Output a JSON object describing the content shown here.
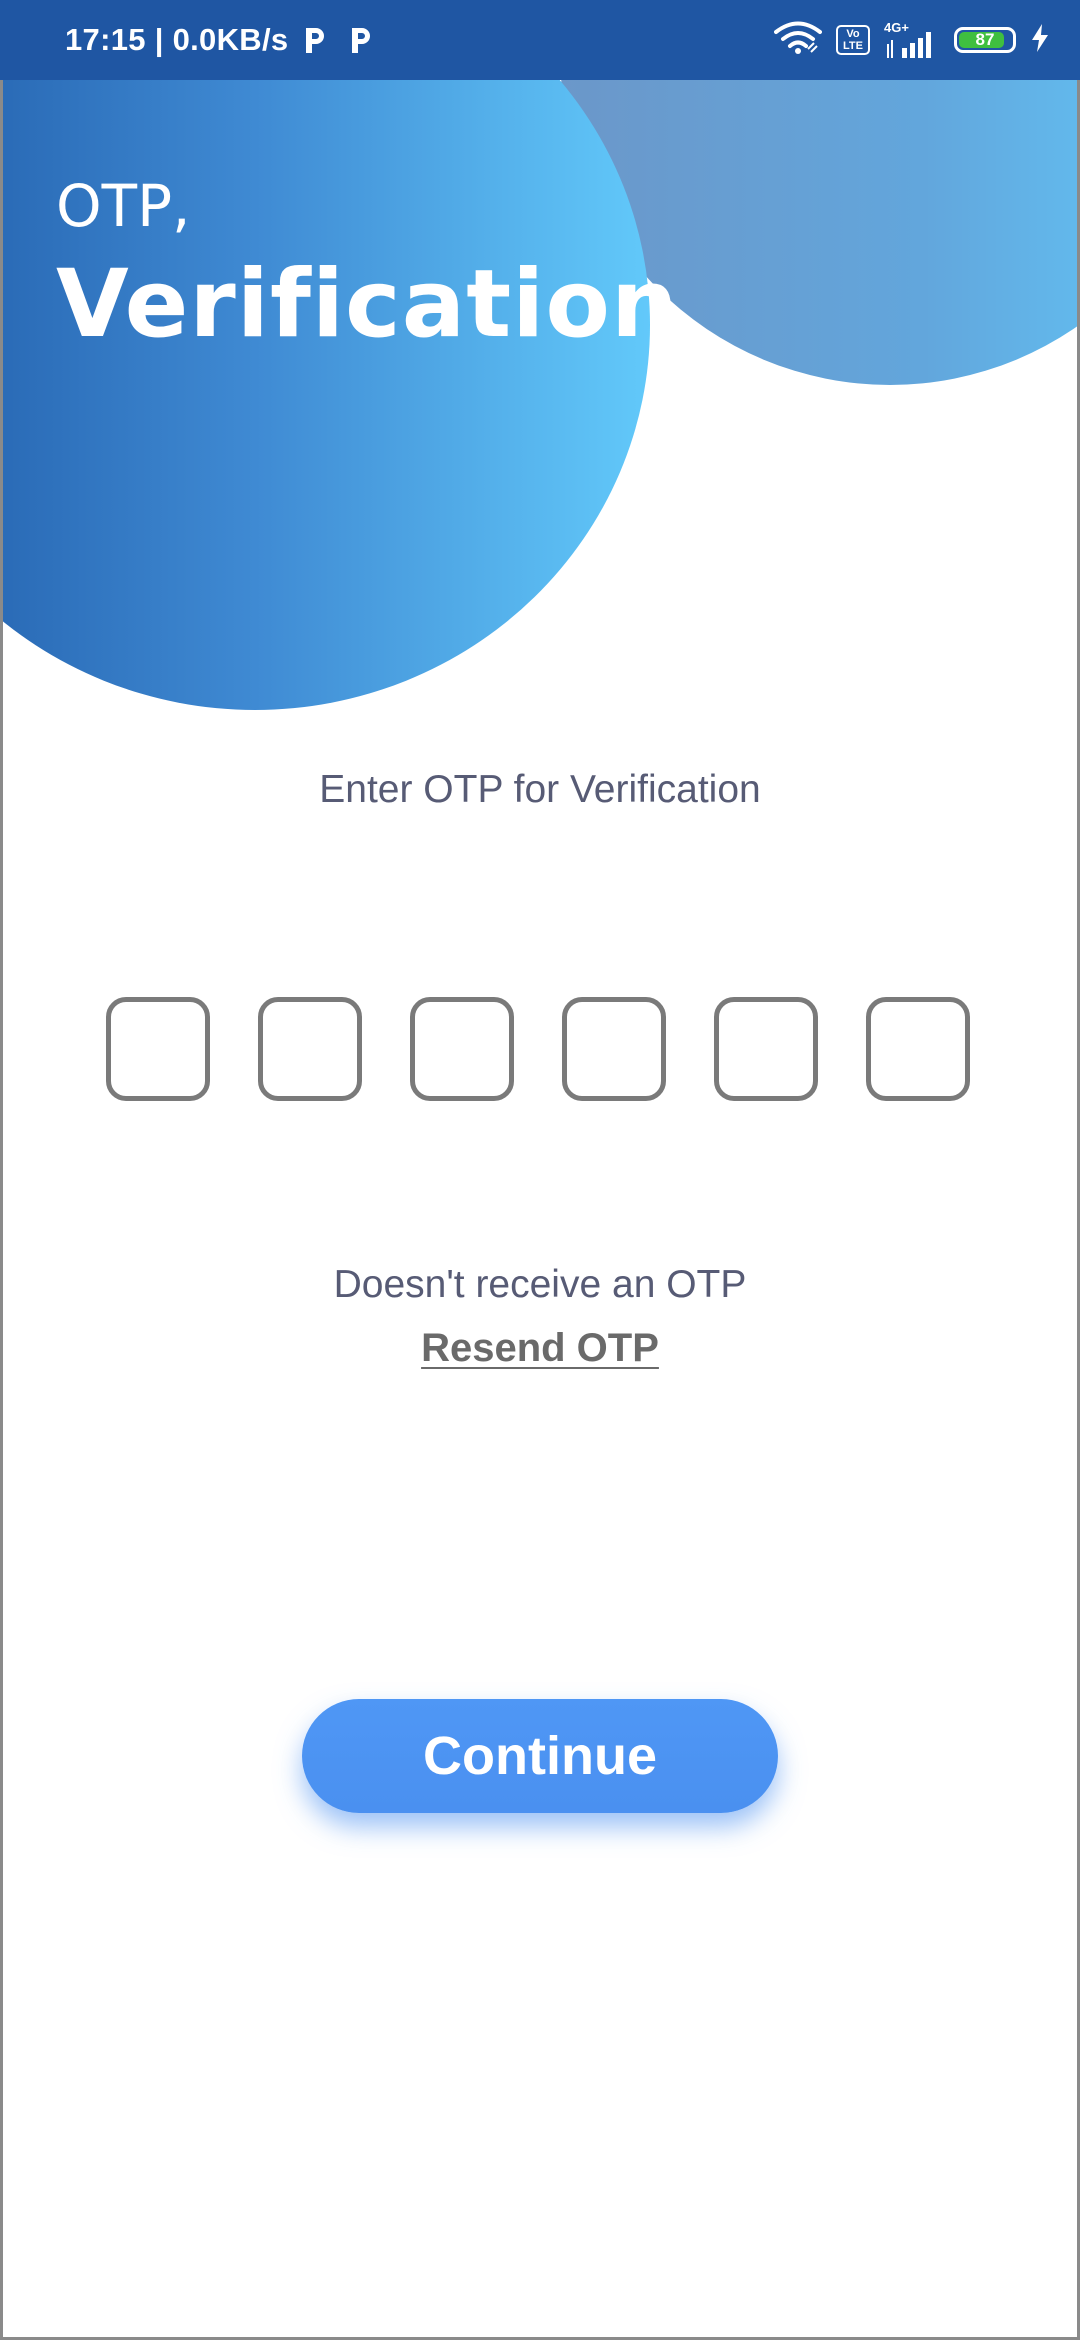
{
  "status_bar": {
    "time_speed": "17:15 | 0.0KB/s",
    "network_type": "4G+",
    "volte_label": "Vo\nLTE",
    "battery_level": "87",
    "battery_fraction": 0.87,
    "icons": [
      "parking-icon",
      "parking-icon",
      "wifi-icon",
      "volte-icon",
      "signal-icon",
      "battery-icon",
      "charging-icon"
    ]
  },
  "header": {
    "pre_title": "OTP,",
    "title": "Verification"
  },
  "main": {
    "prompt": "Enter OTP for Verification",
    "otp_boxes": [
      "",
      "",
      "",
      "",
      "",
      ""
    ],
    "resend_question": "Doesn't receive an OTP",
    "resend_link": "Resend OTP",
    "continue_label": "Continue"
  },
  "colors": {
    "status_bar": "#1f56a3",
    "accent": "#4a90f0",
    "text_muted": "#575b75",
    "box_border": "#7a7a7a"
  }
}
